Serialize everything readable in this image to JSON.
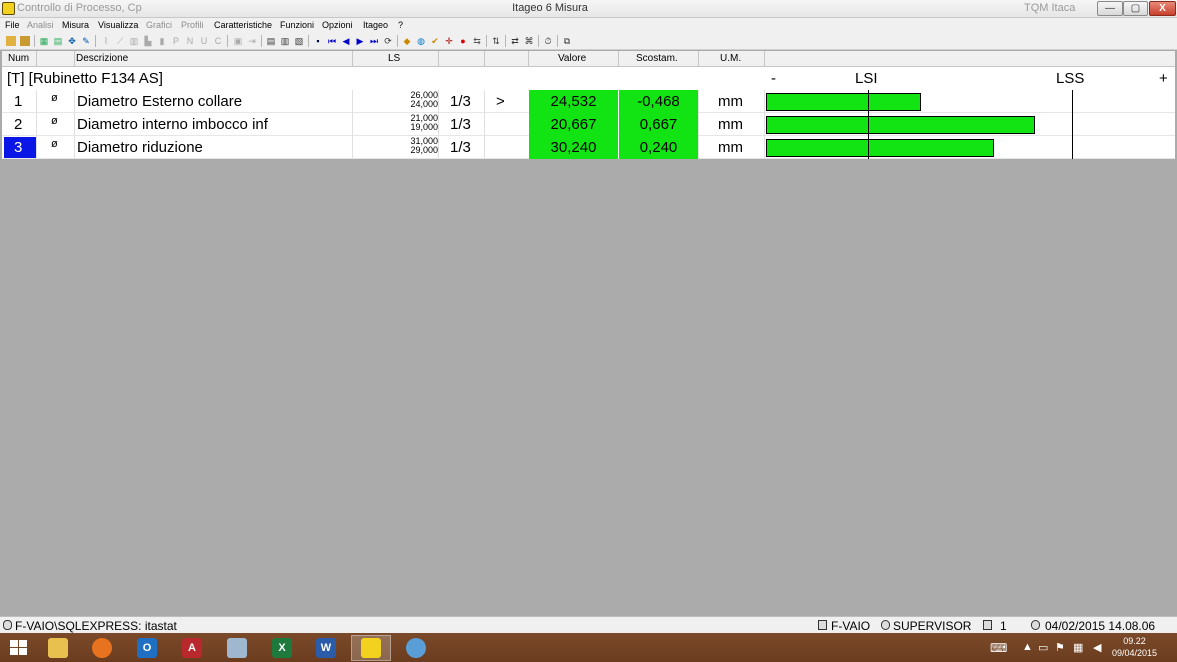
{
  "window": {
    "left_title": "Controllo di Processo, Cp",
    "title": "Itageo 6 Misura",
    "right_title": "TQM Itaca",
    "min_label": "—",
    "max_label": "▢",
    "close_label": "X"
  },
  "menu": [
    {
      "label": "File",
      "enabled": true
    },
    {
      "label": "Analisi",
      "enabled": false
    },
    {
      "label": "Misura",
      "enabled": true
    },
    {
      "label": "Visualizza",
      "enabled": true
    },
    {
      "label": "Grafici",
      "enabled": false
    },
    {
      "label": "Profili",
      "enabled": false
    },
    {
      "label": "Caratteristiche",
      "enabled": true
    },
    {
      "label": "Funzioni",
      "enabled": true
    },
    {
      "label": "Opzioni",
      "enabled": true
    },
    {
      "label": "Itageo",
      "enabled": true
    },
    {
      "label": "?",
      "enabled": true
    }
  ],
  "grid": {
    "headers": {
      "num": "Num",
      "description": "Descrizione",
      "ls": "LS",
      "value": "Valore",
      "deviation": "Scostam.",
      "unit": "U.M."
    },
    "group_title": "[T] [Rubinetto F134 AS]",
    "scale": {
      "minus": "-",
      "lsi": "LSI",
      "lss": "LSS",
      "plus": "+"
    },
    "rows": [
      {
        "num": "1",
        "symbol": "ø",
        "description": "Diametro Esterno collare",
        "upper": "26,000",
        "lower": "24,000",
        "fraction": "1/3",
        "flag": ">",
        "value": "24,532",
        "deviation": "-0,468",
        "unit": "mm",
        "bar_fill": 0.38,
        "selected": false
      },
      {
        "num": "2",
        "symbol": "ø",
        "description": "Diametro interno imbocco inf",
        "upper": "21,000",
        "lower": "19,000",
        "fraction": "1/3",
        "flag": "",
        "value": "20,667",
        "deviation": "0,667",
        "unit": "mm",
        "bar_fill": 0.66,
        "selected": false
      },
      {
        "num": "3",
        "symbol": "ø",
        "description": "Diametro riduzione",
        "upper": "31,000",
        "lower": "29,000",
        "fraction": "1/3",
        "flag": "",
        "value": "30,240",
        "deviation": "0,240",
        "unit": "mm",
        "bar_fill": 0.56,
        "selected": true
      }
    ]
  },
  "status": {
    "connection": "F-VAIO\\SQLEXPRESS: itastat",
    "station": "F-VAIO",
    "user": "SUPERVISOR",
    "count": "1",
    "datetime": "04/02/2015 14.08.06"
  },
  "taskbar": {
    "time": "09.22",
    "date": "09/04/2015"
  },
  "colors": {
    "ok_green": "#12e312",
    "selection_blue": "#0a16e6",
    "workspace_gray": "#ababab"
  }
}
